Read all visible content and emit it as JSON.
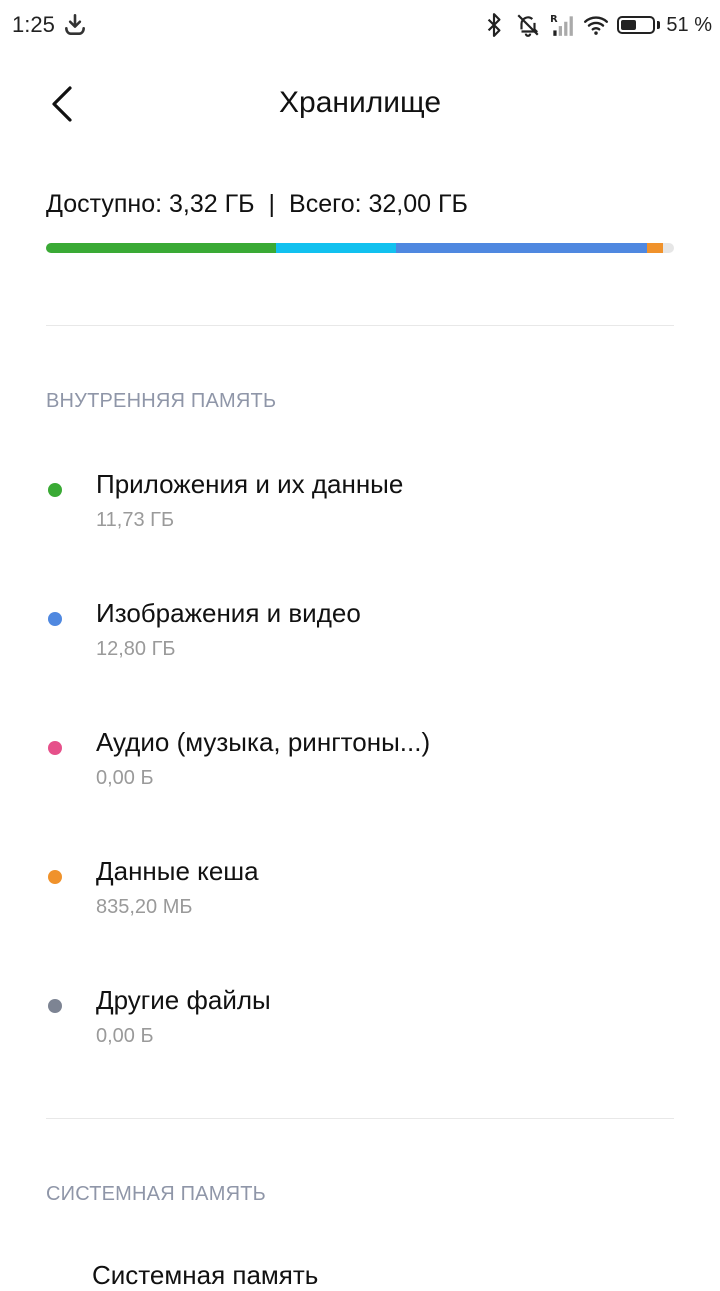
{
  "status_bar": {
    "time": "1:25",
    "battery_text": "51 %",
    "battery_level": 0.51,
    "icons": [
      "download-icon",
      "bluetooth-icon",
      "alarm-off-icon",
      "signal-roaming-icon",
      "wifi-icon",
      "battery-icon"
    ]
  },
  "header": {
    "title": "Хранилище",
    "back_icon": "chevron-left-icon"
  },
  "summary": {
    "available": "Доступно: 3,32 ГБ",
    "separator": "|",
    "total": "Всего: 32,00 ГБ",
    "usage_fractions": [
      {
        "name": "Приложения и их данные",
        "fraction": 0.3666,
        "color": "#3aaa35"
      },
      {
        "name": "Данные кеша (вид.)",
        "fraction": 0.19,
        "color": "#12c1ef"
      },
      {
        "name": "Изображения и видео",
        "fraction": 0.4,
        "color": "#4f88e0"
      },
      {
        "name": "Данные кеша",
        "fraction": 0.0255,
        "color": "#f0922b"
      }
    ]
  },
  "internal": {
    "title": "ВНУТРЕННЯЯ ПАМЯТЬ",
    "items": [
      {
        "label": "Приложения и их данные",
        "size": "11,73 ГБ",
        "color": "#3aaa35"
      },
      {
        "label": "Изображения и видео",
        "size": "12,80 ГБ",
        "color": "#4f88e0"
      },
      {
        "label": "Аудио (музыка, рингтоны...)",
        "size": "0,00 Б",
        "color": "#e6508a"
      },
      {
        "label": "Данные кеша",
        "size": "835,20 МБ",
        "color": "#f0922b"
      },
      {
        "label": "Другие файлы",
        "size": "0,00 Б",
        "color": "#7d8493"
      }
    ]
  },
  "system": {
    "title": "СИСТЕМНАЯ ПАМЯТЬ",
    "item_label": "Системная память"
  }
}
